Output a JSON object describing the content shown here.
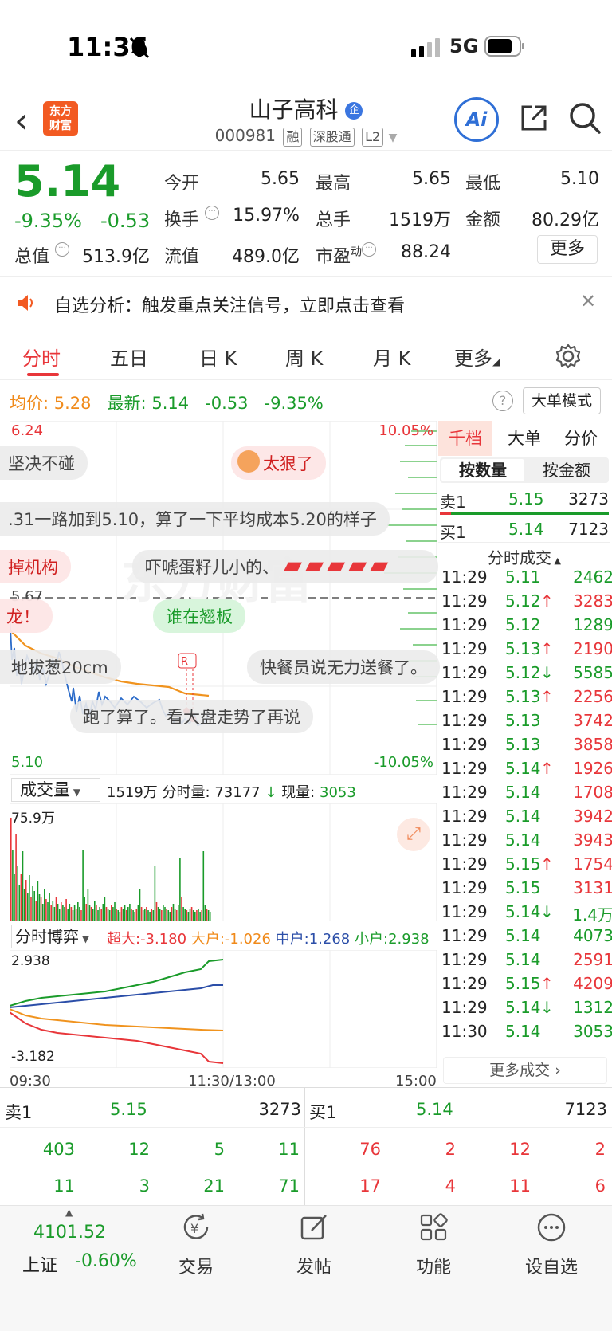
{
  "status": {
    "time": "11:36",
    "network": "5G"
  },
  "header": {
    "stock_name": "山子高科",
    "stock_code": "000981",
    "tags": [
      "融",
      "深股通",
      "L2"
    ],
    "ai_label": "Ai"
  },
  "quote": {
    "price": "5.14",
    "change_pct": "-9.35%",
    "change": "-0.53",
    "fields": [
      {
        "label": "今开",
        "value": "5.65",
        "color": "green"
      },
      {
        "label": "最高",
        "value": "5.65",
        "color": "green"
      },
      {
        "label": "最低",
        "value": "5.10",
        "color": "green"
      },
      {
        "label": "换手",
        "value": "15.97%",
        "color": "black"
      },
      {
        "label": "总手",
        "value": "1519万",
        "color": "black"
      },
      {
        "label": "金额",
        "value": "80.29亿",
        "color": "black"
      },
      {
        "label": "总值",
        "value": "513.9亿",
        "color": "black"
      },
      {
        "label": "流值",
        "value": "489.0亿",
        "color": "black"
      },
      {
        "label": "市盈",
        "value": "88.24",
        "color": "black"
      }
    ],
    "pe_sup": "动",
    "more_label": "更多"
  },
  "notice": {
    "text": "自选分析：触发重点关注信号，立即点击查看"
  },
  "tabs": [
    "分时",
    "五日",
    "日 K",
    "周 K",
    "月 K",
    "更多"
  ],
  "info_line": {
    "avg_label": "均价:",
    "avg_value": "5.28",
    "latest_label": "最新:",
    "latest_value": "5.14",
    "change": "-0.53",
    "change_pct": "-9.35%",
    "mode_label": "大单模式"
  },
  "chart_labels": {
    "top_price": "6.24",
    "top_pct": "10.05%",
    "mid_price": "5.67",
    "bottom_price": "5.10",
    "bottom_pct": "-10.05%",
    "volume_label": "成交量",
    "volume_info_total": "1519万",
    "volume_info_minute_label": "分时量:",
    "volume_info_minute_value": "73177",
    "volume_info_now_label": "现量:",
    "volume_info_now_value": "3053",
    "volume_max": "75.9万",
    "game_label": "分时博弈",
    "game_super": "超大:-3.180",
    "game_big": "大户:-1.026",
    "game_mid": "中户:1.268",
    "game_small": "小户:2.938",
    "game_top": "2.938",
    "game_bottom": "-3.182",
    "time_start": "09:30",
    "time_mid": "11:30/13:00",
    "time_end": "15:00"
  },
  "danmu": [
    "坚决不碰",
    "太狠了",
    ".31一路加到5.10，算了一下平均成本5.20的样子",
    "掉机构",
    "吓唬蛋籽儿小的、",
    "龙！",
    "谁在翘板",
    "地拔葱20cm",
    "快餐员说无力送餐了。",
    "跑了算了。看大盘走势了再说"
  ],
  "right_panel": {
    "tabs": [
      "千档",
      "大单",
      "分价"
    ],
    "subtabs": [
      "按数量",
      "按金额"
    ],
    "sell1": {
      "label": "卖1",
      "price": "5.15",
      "vol": "3273"
    },
    "buy1": {
      "label": "买1",
      "price": "5.14",
      "vol": "7123"
    },
    "ticks_title": "分时成交",
    "ticks": [
      {
        "t": "11:29",
        "p": "5.11",
        "arrow": "",
        "v": "2462",
        "vc": "green"
      },
      {
        "t": "11:29",
        "p": "5.12",
        "arrow": "↑",
        "v": "3283",
        "vc": "red"
      },
      {
        "t": "11:29",
        "p": "5.12",
        "arrow": "",
        "v": "1289",
        "vc": "green"
      },
      {
        "t": "11:29",
        "p": "5.13",
        "arrow": "↑",
        "v": "2190",
        "vc": "red"
      },
      {
        "t": "11:29",
        "p": "5.12",
        "arrow": "↓",
        "v": "5585",
        "vc": "green"
      },
      {
        "t": "11:29",
        "p": "5.13",
        "arrow": "↑",
        "v": "2256",
        "vc": "red"
      },
      {
        "t": "11:29",
        "p": "5.13",
        "arrow": "",
        "v": "3742",
        "vc": "red"
      },
      {
        "t": "11:29",
        "p": "5.13",
        "arrow": "",
        "v": "3858",
        "vc": "red"
      },
      {
        "t": "11:29",
        "p": "5.14",
        "arrow": "↑",
        "v": "1926",
        "vc": "red"
      },
      {
        "t": "11:29",
        "p": "5.14",
        "arrow": "",
        "v": "1708",
        "vc": "red"
      },
      {
        "t": "11:29",
        "p": "5.14",
        "arrow": "",
        "v": "3942",
        "vc": "red"
      },
      {
        "t": "11:29",
        "p": "5.14",
        "arrow": "",
        "v": "3943",
        "vc": "red"
      },
      {
        "t": "11:29",
        "p": "5.15",
        "arrow": "↑",
        "v": "1754",
        "vc": "red"
      },
      {
        "t": "11:29",
        "p": "5.15",
        "arrow": "",
        "v": "3131",
        "vc": "red"
      },
      {
        "t": "11:29",
        "p": "5.14",
        "arrow": "↓",
        "v": "1.4万",
        "vc": "green"
      },
      {
        "t": "11:29",
        "p": "5.14",
        "arrow": "",
        "v": "4073",
        "vc": "green"
      },
      {
        "t": "11:29",
        "p": "5.14",
        "arrow": "",
        "v": "2591",
        "vc": "red"
      },
      {
        "t": "11:29",
        "p": "5.15",
        "arrow": "↑",
        "v": "4209",
        "vc": "red"
      },
      {
        "t": "11:29",
        "p": "5.14",
        "arrow": "↓",
        "v": "1312",
        "vc": "green"
      },
      {
        "t": "11:30",
        "p": "5.14",
        "arrow": "",
        "v": "3053",
        "vc": "green"
      }
    ],
    "more_ticks": "更多成交"
  },
  "order_book": {
    "sell_label": "卖1",
    "sell_price": "5.15",
    "sell_vol": "3273",
    "buy_label": "买1",
    "buy_price": "5.14",
    "buy_vol": "7123",
    "sell_row1": [
      "403",
      "12",
      "5",
      "11"
    ],
    "sell_row2": [
      "11",
      "3",
      "21",
      "71"
    ],
    "buy_row1": [
      "76",
      "2",
      "12",
      "2"
    ],
    "buy_row2": [
      "17",
      "4",
      "11",
      "6"
    ]
  },
  "nav": {
    "index_value": "4101.52",
    "index_name": "上证",
    "index_change": "-0.60%",
    "items": [
      "交易",
      "发帖",
      "功能",
      "设自选"
    ]
  }
}
